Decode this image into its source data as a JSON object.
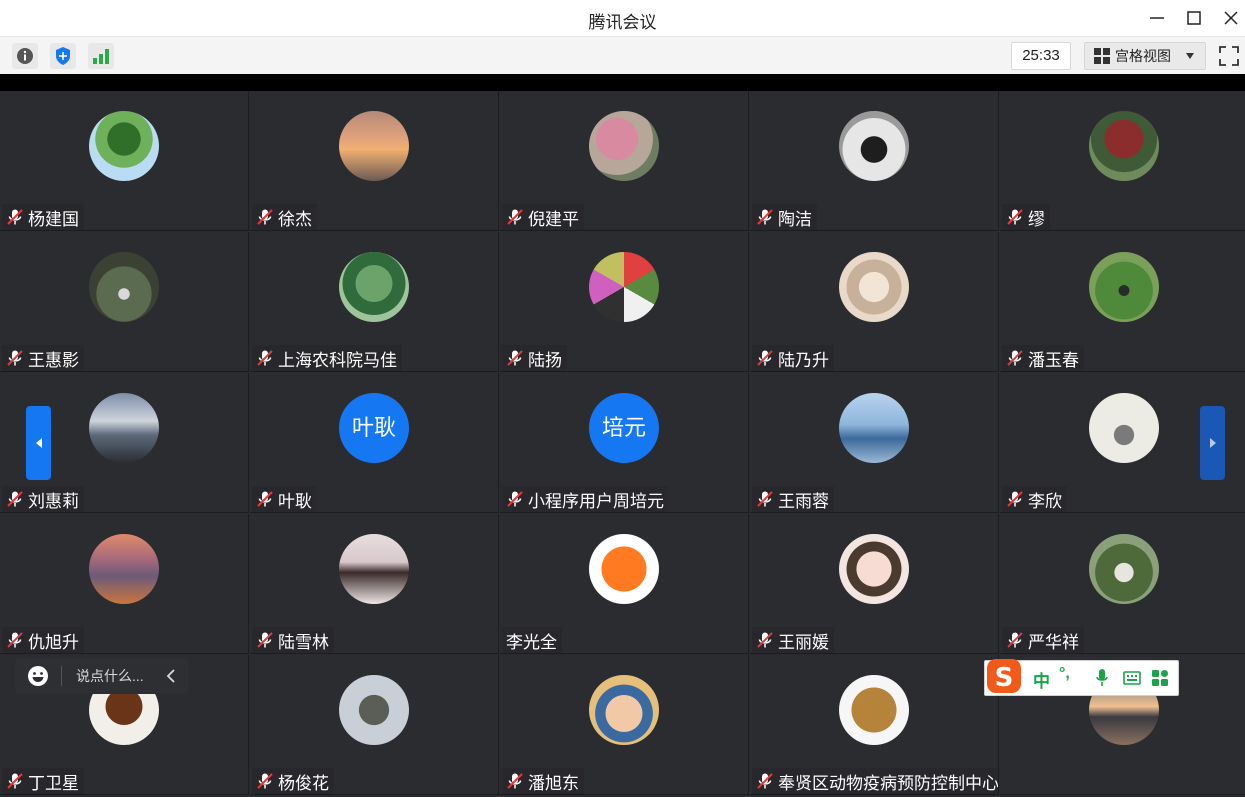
{
  "window": {
    "title": "腾讯会议"
  },
  "toolbar": {
    "info_icon": "info-icon",
    "security_icon": "shield-icon",
    "signal_icon": "signal-icon",
    "timer": "25:33",
    "view_label": "宫格视图"
  },
  "colors": {
    "accent_blue": "#1677f2",
    "signal_green": "#2ea84a",
    "mic_off_red": "#e03a3a",
    "tile_bg": "#2b2c30"
  },
  "participants": [
    {
      "name": "杨建国",
      "avatar": "tree-photo",
      "muted": true
    },
    {
      "name": "徐杰",
      "avatar": "sunset-photo",
      "muted": true
    },
    {
      "name": "倪建平",
      "avatar": "blossom-photo",
      "muted": true
    },
    {
      "name": "陶洁",
      "avatar": "horse-rider-photo",
      "muted": true
    },
    {
      "name": "缪",
      "avatar": "red-tree-photo",
      "muted": true
    },
    {
      "name": "王惠影",
      "avatar": "forest-photo",
      "muted": true
    },
    {
      "name": "上海农科院马佳",
      "avatar": "green-park-photo",
      "muted": true
    },
    {
      "name": "陆扬",
      "avatar": "pattern-photo",
      "muted": true
    },
    {
      "name": "陆乃升",
      "avatar": "family-photo",
      "muted": true
    },
    {
      "name": "潘玉春",
      "avatar": "person-park-photo",
      "muted": true
    },
    {
      "name": "刘惠莉",
      "avatar": "beach-sky-photo",
      "muted": true
    },
    {
      "name": "叶耿",
      "avatar_text": "叶耿",
      "muted": true
    },
    {
      "name": "小程序用户周培元",
      "avatar_text": "培元",
      "muted": true
    },
    {
      "name": "王雨蓉",
      "avatar": "city-window-photo",
      "muted": true
    },
    {
      "name": "李欣",
      "avatar": "ink-painting-photo",
      "muted": true
    },
    {
      "name": "仇旭升",
      "avatar": "mountain-photo",
      "muted": true
    },
    {
      "name": "陆雪林",
      "avatar": "misty-lake-photo",
      "muted": true
    },
    {
      "name": "李光全",
      "avatar": "angry-emoji-avatar",
      "muted": false
    },
    {
      "name": "王丽媛",
      "avatar": "girl-portrait-photo",
      "muted": true
    },
    {
      "name": "严华祥",
      "avatar": "stone-photo",
      "muted": true
    },
    {
      "name": "丁卫星",
      "avatar": "mushroom-photo",
      "muted": true
    },
    {
      "name": "杨俊花",
      "avatar": "statue-photo",
      "muted": true
    },
    {
      "name": "潘旭东",
      "avatar": "baby-photo",
      "muted": true
    },
    {
      "name": "奉贤区动物疫病预防控制中心马婧姣",
      "avatar": "quokka-photo",
      "muted": true
    },
    {
      "name": "",
      "avatar": "lake-sunset-photo",
      "muted": false
    }
  ],
  "chat": {
    "placeholder": "说点什么..."
  },
  "ime": {
    "mode_label": "中",
    "punct_label": "°,"
  }
}
